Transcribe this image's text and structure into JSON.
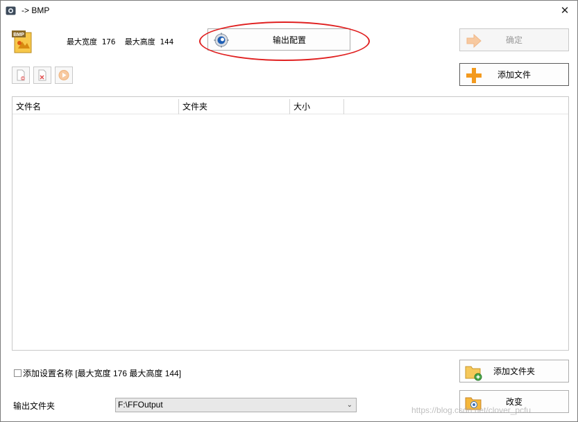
{
  "window": {
    "title": "-> BMP",
    "close_glyph": "✕"
  },
  "format": {
    "icon": "bmp-file-icon",
    "icon_text": "BMP",
    "size_info": "最大宽度 176  最大高度 144"
  },
  "buttons": {
    "output_config": "输出配置",
    "confirm": "确定",
    "add_file": "添加文件",
    "add_folder": "添加文件夹",
    "change": "改变"
  },
  "toolbar": {
    "items": [
      "remove-file-icon",
      "clear-list-icon",
      "play-icon"
    ]
  },
  "file_list": {
    "columns": [
      "文件名",
      "文件夹",
      "大小"
    ],
    "rows": []
  },
  "bottom": {
    "append_setting_label": "添加设置名称 [最大宽度 176  最大高度 144]",
    "append_setting_checked": false,
    "output_folder_label": "输出文件夹",
    "output_folder_value": "F:\\FFOutput"
  },
  "watermark": "https://blog.csdn.net/clover_pcfu",
  "colors": {
    "annotation_red": "#e02020",
    "accent_orange": "#f39a1e"
  }
}
